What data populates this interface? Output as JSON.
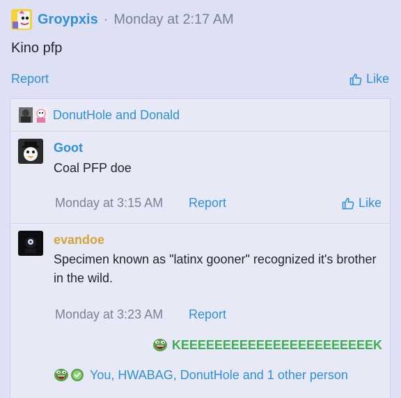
{
  "post": {
    "author": "Groypxis",
    "separator": "·",
    "timestamp": "Monday at 2:17 AM",
    "body": "Kino pfp",
    "report_label": "Report",
    "like_label": "Like"
  },
  "comments_section": {
    "reactors_text": "DonutHole and Donald",
    "comments": [
      {
        "author": "Goot",
        "text": "Coal PFP doe",
        "timestamp": "Monday at 3:15 AM",
        "report_label": "Report",
        "like_label": "Like"
      },
      {
        "author": "evandoe",
        "text": "Specimen known as \"latinx gooner\" recognized it's brother in the wild.",
        "timestamp": "Monday at 3:23 AM",
        "report_label": "Report",
        "reaction_label": "KEEEEEEEEEEEEEEEEEEEEEEEK",
        "reactions_text": "You, HWABAG, DonutHole and 1 other person"
      }
    ]
  },
  "colors": {
    "background": "#dde1f3",
    "link": "#2f8fd8",
    "muted": "#7b8094",
    "gold_name": "#d4a43a",
    "reaction_green": "#3fae52"
  },
  "icons": [
    "thumbs-up-icon",
    "pepe-laugh-icon",
    "check-badge-icon"
  ]
}
